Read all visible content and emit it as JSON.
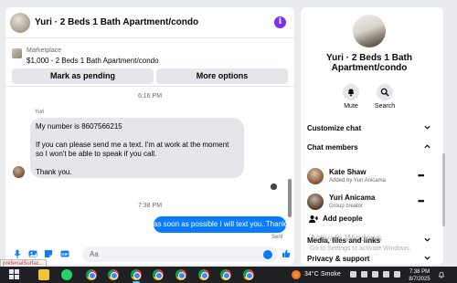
{
  "chat": {
    "title": "Yuri · 2 Beds 1 Bath Apartment/condo",
    "marketplace_label": "Marketplace",
    "listing": "$1,000 - 2 Beds 1 Bath Apartment/condo",
    "mark_pending_label": "Mark as pending",
    "more_options_label": "More options",
    "messages": {
      "timestamp_1": "6:16 PM",
      "sender_name": "Yuri",
      "incoming_line1": "My number is 8607566215",
      "incoming_line2": "If you can please send me a text. I'm at work at the moment so I won't be able to speak if you call.",
      "incoming_line3": "Thank you.",
      "timestamp_2": "7:38 PM",
      "outgoing": "as soon as possible I will text you..Thanks",
      "outgoing_status": "Sent"
    },
    "composer_placeholder": "Aa"
  },
  "info": {
    "name": "Yuri · 2 Beds 1 Bath Apartment/condo",
    "mute_label": "Mute",
    "search_label": "Search",
    "customize_label": "Customize chat",
    "members_label": "Chat members",
    "members": [
      {
        "name": "Kate Shaw",
        "subtitle": "Added by Yuri Anicama"
      },
      {
        "name": "Yuri Anicama",
        "subtitle": "Group creator"
      }
    ],
    "add_people_label": "Add people",
    "media_label": "Media, files and links",
    "privacy_label": "Privacy & support"
  },
  "watermark": {
    "line1": "Activate Windows",
    "line2": "Go to Settings to activate Windows."
  },
  "tooltip": "preferralSurfac...",
  "taskbar": {
    "temperature": "34°C",
    "condition": "Smoke",
    "time": "7:38 PM",
    "date": "8/7/2025"
  },
  "colors": {
    "accent": "#0a7cff",
    "bubble_in": "#e4e6eb",
    "taskbar": "#1f2024"
  }
}
